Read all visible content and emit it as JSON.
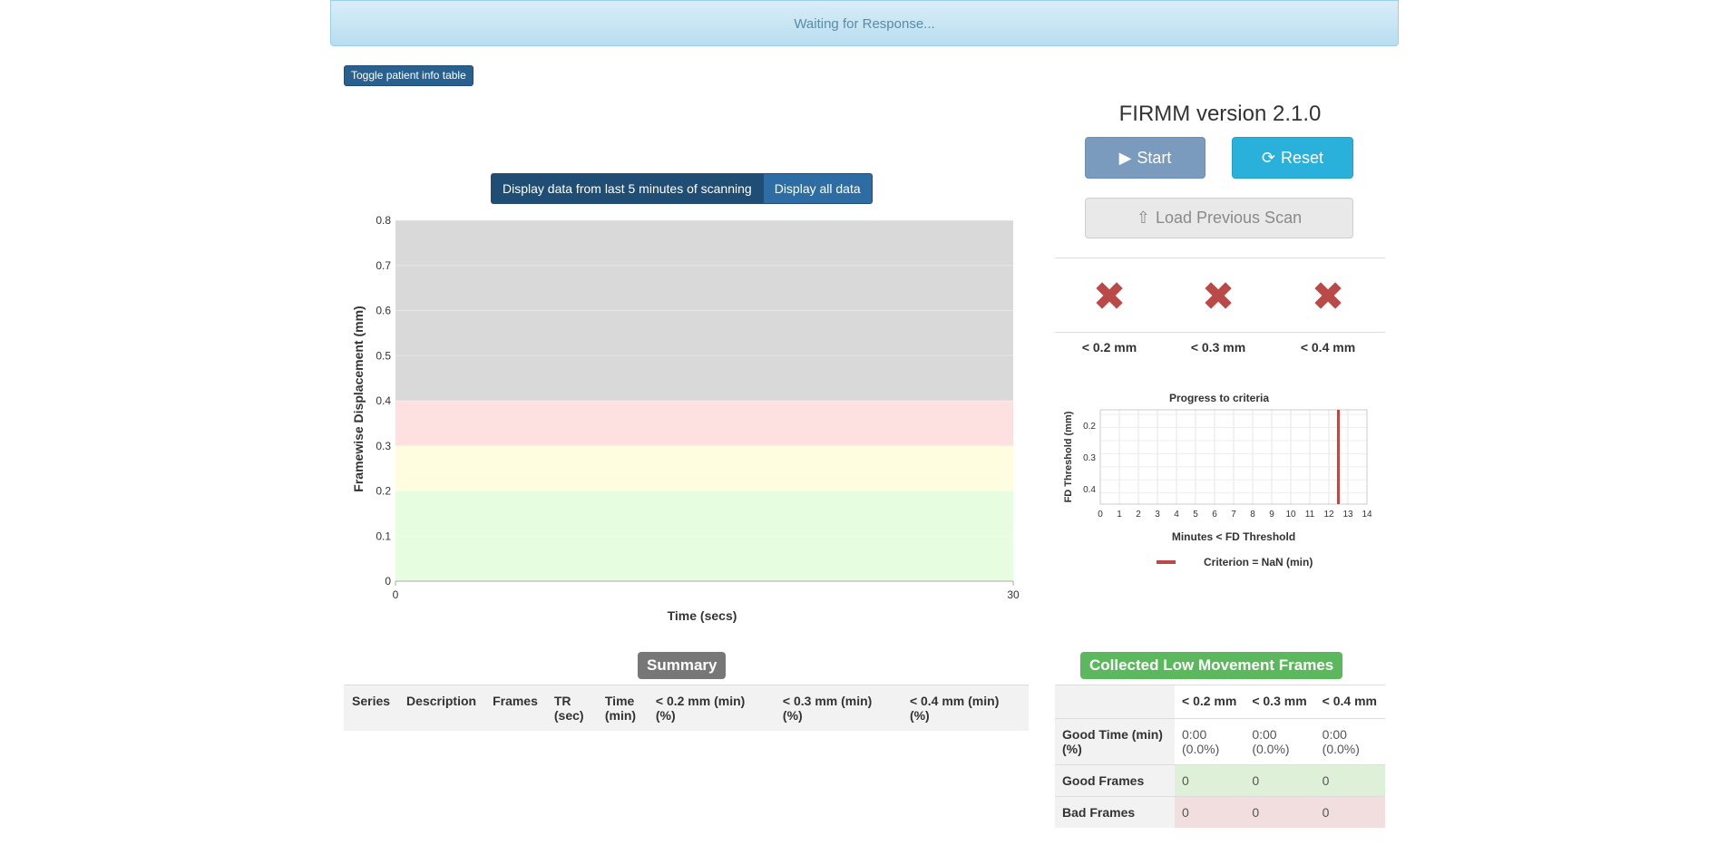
{
  "status_banner": "Waiting for Response...",
  "toggle_button": "Toggle patient info table",
  "range_buttons": {
    "recent": "Display data from last 5 minutes of scanning",
    "all": "Display all data"
  },
  "fd_chart": {
    "ylabel": "Framewise Displacement (mm)",
    "xlabel": "Time (secs)",
    "x_ticks": [
      "0",
      "30"
    ],
    "y_ticks": [
      "0",
      "0.1",
      "0.2",
      "0.3",
      "0.4",
      "0.5",
      "0.6",
      "0.7",
      "0.8"
    ]
  },
  "chart_data": [
    {
      "type": "area",
      "title": "",
      "xlabel": "Time (secs)",
      "ylabel": "Framewise Displacement (mm)",
      "xlim": [
        0,
        30
      ],
      "ylim": [
        0,
        0.8
      ],
      "bands": [
        {
          "from": 0,
          "to": 0.2,
          "color": "#e6fde0"
        },
        {
          "from": 0.2,
          "to": 0.3,
          "color": "#fefde0"
        },
        {
          "from": 0.3,
          "to": 0.4,
          "color": "#fde0e0"
        },
        {
          "from": 0.4,
          "to": 0.8,
          "color": "#d9d9d9"
        }
      ],
      "series": []
    },
    {
      "type": "bar",
      "title": "Progress to criteria",
      "xlabel": "Minutes < FD Threshold",
      "ylabel": "FD Threshold (mm)",
      "categories": [
        "0.2",
        "0.3",
        "0.4"
      ],
      "x_ticks": [
        "0",
        "1",
        "2",
        "3",
        "4",
        "5",
        "6",
        "7",
        "8",
        "9",
        "10",
        "11",
        "12",
        "13",
        "14"
      ],
      "xlim": [
        0,
        14
      ],
      "criterion_line": 12.5,
      "legend": "Criterion = NaN (min)",
      "criterion_color": "#b94a48",
      "series": []
    }
  ],
  "app": {
    "title": "FIRMM version 2.1.0",
    "start": "Start",
    "reset": "Reset",
    "load": "Load Previous Scan"
  },
  "criteria": [
    {
      "label": "< 0.2 mm",
      "icon": "x-icon"
    },
    {
      "label": "< 0.3 mm",
      "icon": "x-icon"
    },
    {
      "label": "< 0.4 mm",
      "icon": "x-icon"
    }
  ],
  "progress_chart": {
    "title": "Progress to criteria",
    "xlabel": "Minutes < FD Threshold",
    "ylabel": "FD Threshold (mm)",
    "legend": "Criterion = NaN (min)",
    "x_ticks": [
      "0",
      "1",
      "2",
      "3",
      "4",
      "5",
      "6",
      "7",
      "8",
      "9",
      "10",
      "11",
      "12",
      "13",
      "14"
    ],
    "y_ticks": [
      "0.2",
      "0.3",
      "0.4"
    ]
  },
  "summary": {
    "title": "Summary",
    "columns": [
      "Series",
      "Description",
      "Frames",
      "TR (sec)",
      "Time (min)",
      "< 0.2 mm (min) (%)",
      "< 0.3 mm (min) (%)",
      "< 0.4 mm (min) (%)"
    ]
  },
  "collected": {
    "title": "Collected Low Movement Frames",
    "headers": [
      "< 0.2 mm",
      "< 0.3 mm",
      "< 0.4 mm"
    ],
    "rows": [
      {
        "label": "Good Time (min) (%)",
        "values": [
          "0:00 (0.0%)",
          "0:00 (0.0%)",
          "0:00 (0.0%)"
        ]
      },
      {
        "label": "Good Frames",
        "values": [
          "0",
          "0",
          "0"
        ]
      },
      {
        "label": "Bad Frames",
        "values": [
          "0",
          "0",
          "0"
        ]
      }
    ]
  }
}
